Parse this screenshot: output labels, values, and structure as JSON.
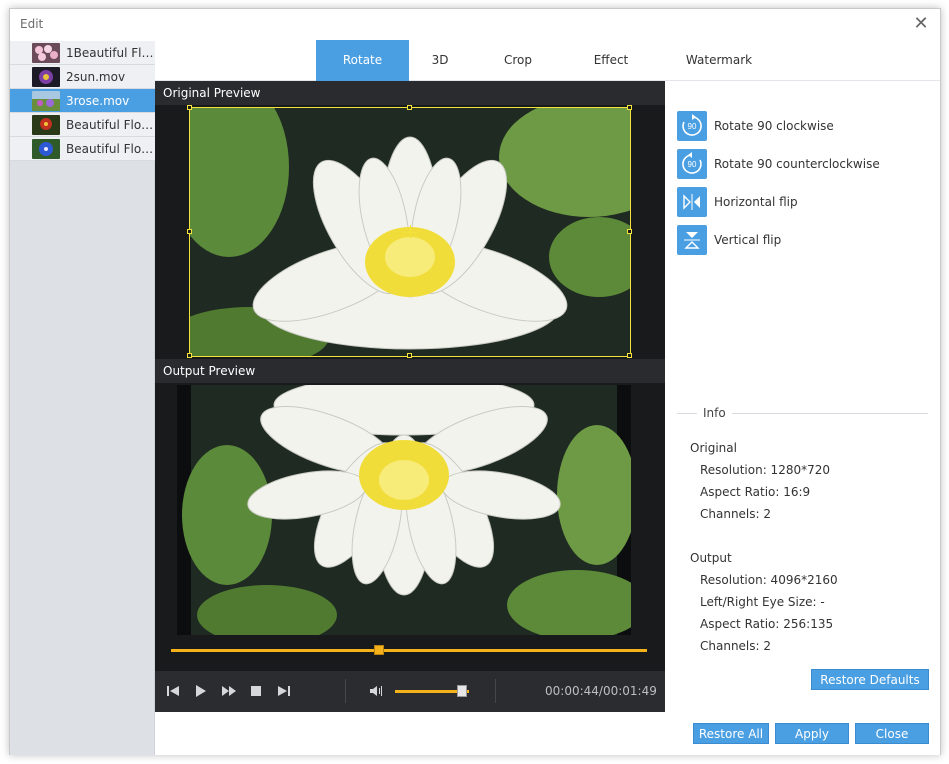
{
  "window": {
    "title": "Edit",
    "close_glyph": "✕"
  },
  "files": [
    {
      "label": "1Beautiful Flo...",
      "thumb": "pink-flowers",
      "selected": false
    },
    {
      "label": "2sun.mov",
      "thumb": "purple-flower",
      "selected": false
    },
    {
      "label": "3rose.mov",
      "thumb": "tulip-field",
      "selected": true
    },
    {
      "label": "Beautiful Flow...",
      "thumb": "red-flower",
      "selected": false
    },
    {
      "label": "Beautiful Flow...",
      "thumb": "blue-flower",
      "selected": false
    }
  ],
  "tabs": [
    {
      "label": "Rotate",
      "active": true
    },
    {
      "label": "3D",
      "active": false
    },
    {
      "label": "Crop",
      "active": false
    },
    {
      "label": "Effect",
      "active": false
    },
    {
      "label": "Watermark",
      "active": false
    }
  ],
  "preview": {
    "original_label": "Original Preview",
    "output_label": "Output Preview",
    "progress_fraction": 0.437,
    "volume_fraction": 0.9,
    "timecode": "00:00:44/00:01:49"
  },
  "controls": {
    "icons": [
      "previous-icon",
      "play-icon",
      "fast-forward-icon",
      "stop-icon",
      "next-icon",
      "volume-icon"
    ]
  },
  "actions": [
    {
      "label": "Rotate 90 clockwise",
      "icon": "rotate-clockwise-icon",
      "badge": "90"
    },
    {
      "label": "Rotate 90 counterclockwise",
      "icon": "rotate-counterclockwise-icon",
      "badge": "90"
    },
    {
      "label": "Horizontal flip",
      "icon": "horizontal-flip-icon"
    },
    {
      "label": "Vertical flip",
      "icon": "vertical-flip-icon"
    }
  ],
  "info": {
    "title": "Info",
    "original_heading": "Original",
    "original": {
      "resolution": "Resolution: 1280*720",
      "aspect": "Aspect Ratio: 16:9",
      "channels": "Channels: 2"
    },
    "output_heading": "Output",
    "output": {
      "resolution": "Resolution: 4096*2160",
      "eye_size": "Left/Right Eye Size: -",
      "aspect": "Aspect Ratio: 256:135",
      "channels": "Channels: 2"
    }
  },
  "buttons": {
    "restore_defaults": "Restore Defaults",
    "restore_all": "Restore All",
    "apply": "Apply",
    "close": "Close"
  },
  "colors": {
    "accent": "#4a9fe3",
    "crop_frame": "#f2e23b",
    "progress": "#f5b21a",
    "preview_bg": "#191a1c"
  }
}
